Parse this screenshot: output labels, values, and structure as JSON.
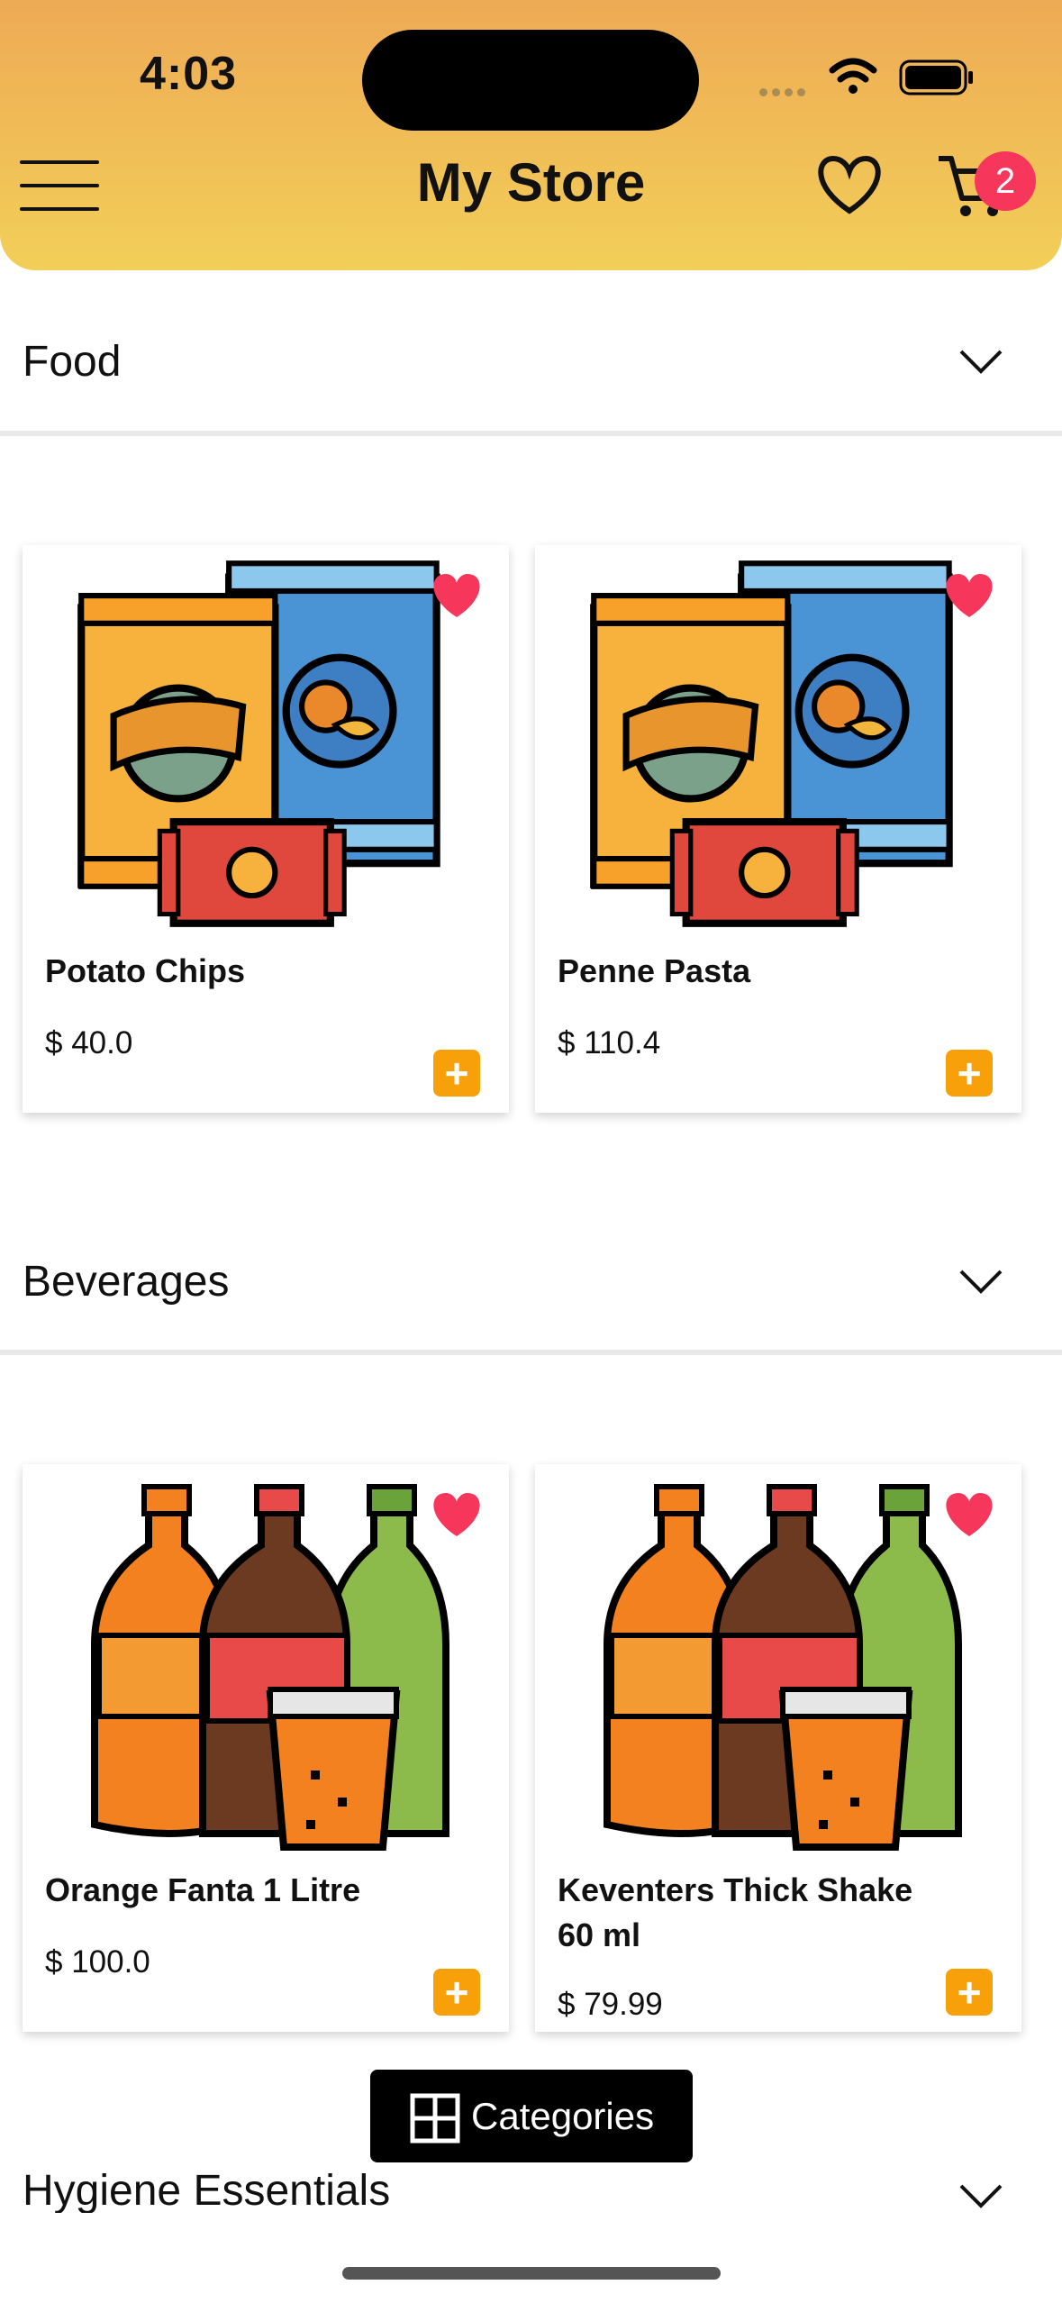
{
  "status": {
    "time": "4:03"
  },
  "header": {
    "title": "My Store",
    "cart_count": "2"
  },
  "sections": [
    {
      "label": "Food",
      "products": [
        {
          "name": "Potato Chips",
          "price": "$ 40.0"
        },
        {
          "name": "Penne Pasta",
          "price": "$ 110.4"
        }
      ]
    },
    {
      "label": "Beverages",
      "products": [
        {
          "name": "Orange Fanta 1 Litre",
          "price": "$ 100.0"
        },
        {
          "name": "Keventers Thick Shake 60 ml",
          "price": "$ 79.99"
        }
      ]
    },
    {
      "label": "Hygiene Essentials",
      "products": []
    }
  ],
  "categories_button": {
    "label": "Categories"
  },
  "icons": {
    "menu": "menu-icon",
    "favorites": "heart-icon",
    "cart": "cart-icon",
    "expand": "chevron-down-icon",
    "favorite_marked": "heart-filled-icon",
    "add": "plus-icon",
    "categories": "grid-icon",
    "chips": "snack-packs-icon",
    "drinks": "soda-bottles-icon"
  },
  "colors": {
    "header_top": "#eeaa55",
    "header_bottom": "#f2cf58",
    "badge": "#f6365b",
    "favorite": "#f6365b",
    "add_button": "#f7a00a"
  }
}
